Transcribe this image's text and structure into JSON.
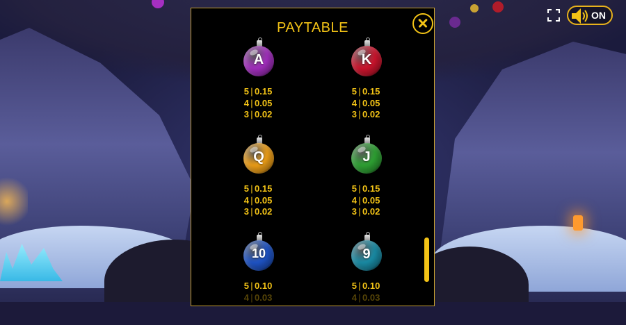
{
  "sound": {
    "label": "ON"
  },
  "paytable": {
    "title": "PAYTABLE",
    "symbols": [
      {
        "letter": "A",
        "color": "#a52fc1",
        "pays": [
          {
            "count": "5",
            "value": "0.15"
          },
          {
            "count": "4",
            "value": "0.05"
          },
          {
            "count": "3",
            "value": "0.02"
          }
        ]
      },
      {
        "letter": "K",
        "color": "#d0152e",
        "pays": [
          {
            "count": "5",
            "value": "0.15"
          },
          {
            "count": "4",
            "value": "0.05"
          },
          {
            "count": "3",
            "value": "0.02"
          }
        ]
      },
      {
        "letter": "Q",
        "color": "#f0a018",
        "pays": [
          {
            "count": "5",
            "value": "0.15"
          },
          {
            "count": "4",
            "value": "0.05"
          },
          {
            "count": "3",
            "value": "0.02"
          }
        ]
      },
      {
        "letter": "J",
        "color": "#2fa434",
        "pays": [
          {
            "count": "5",
            "value": "0.15"
          },
          {
            "count": "4",
            "value": "0.05"
          },
          {
            "count": "3",
            "value": "0.02"
          }
        ]
      },
      {
        "letter": "10",
        "color": "#1f55c9",
        "pays": [
          {
            "count": "5",
            "value": "0.10"
          },
          {
            "count": "4",
            "value": "0.03"
          }
        ]
      },
      {
        "letter": "9",
        "color": "#1a8ea8",
        "pays": [
          {
            "count": "5",
            "value": "0.10"
          },
          {
            "count": "4",
            "value": "0.03"
          }
        ]
      }
    ]
  },
  "icons": {
    "fullscreen": "fullscreen-icon",
    "speaker": "speaker-icon",
    "close": "close-icon"
  },
  "colors": {
    "accent": "#f3c316",
    "panel_bg": "#000000"
  }
}
